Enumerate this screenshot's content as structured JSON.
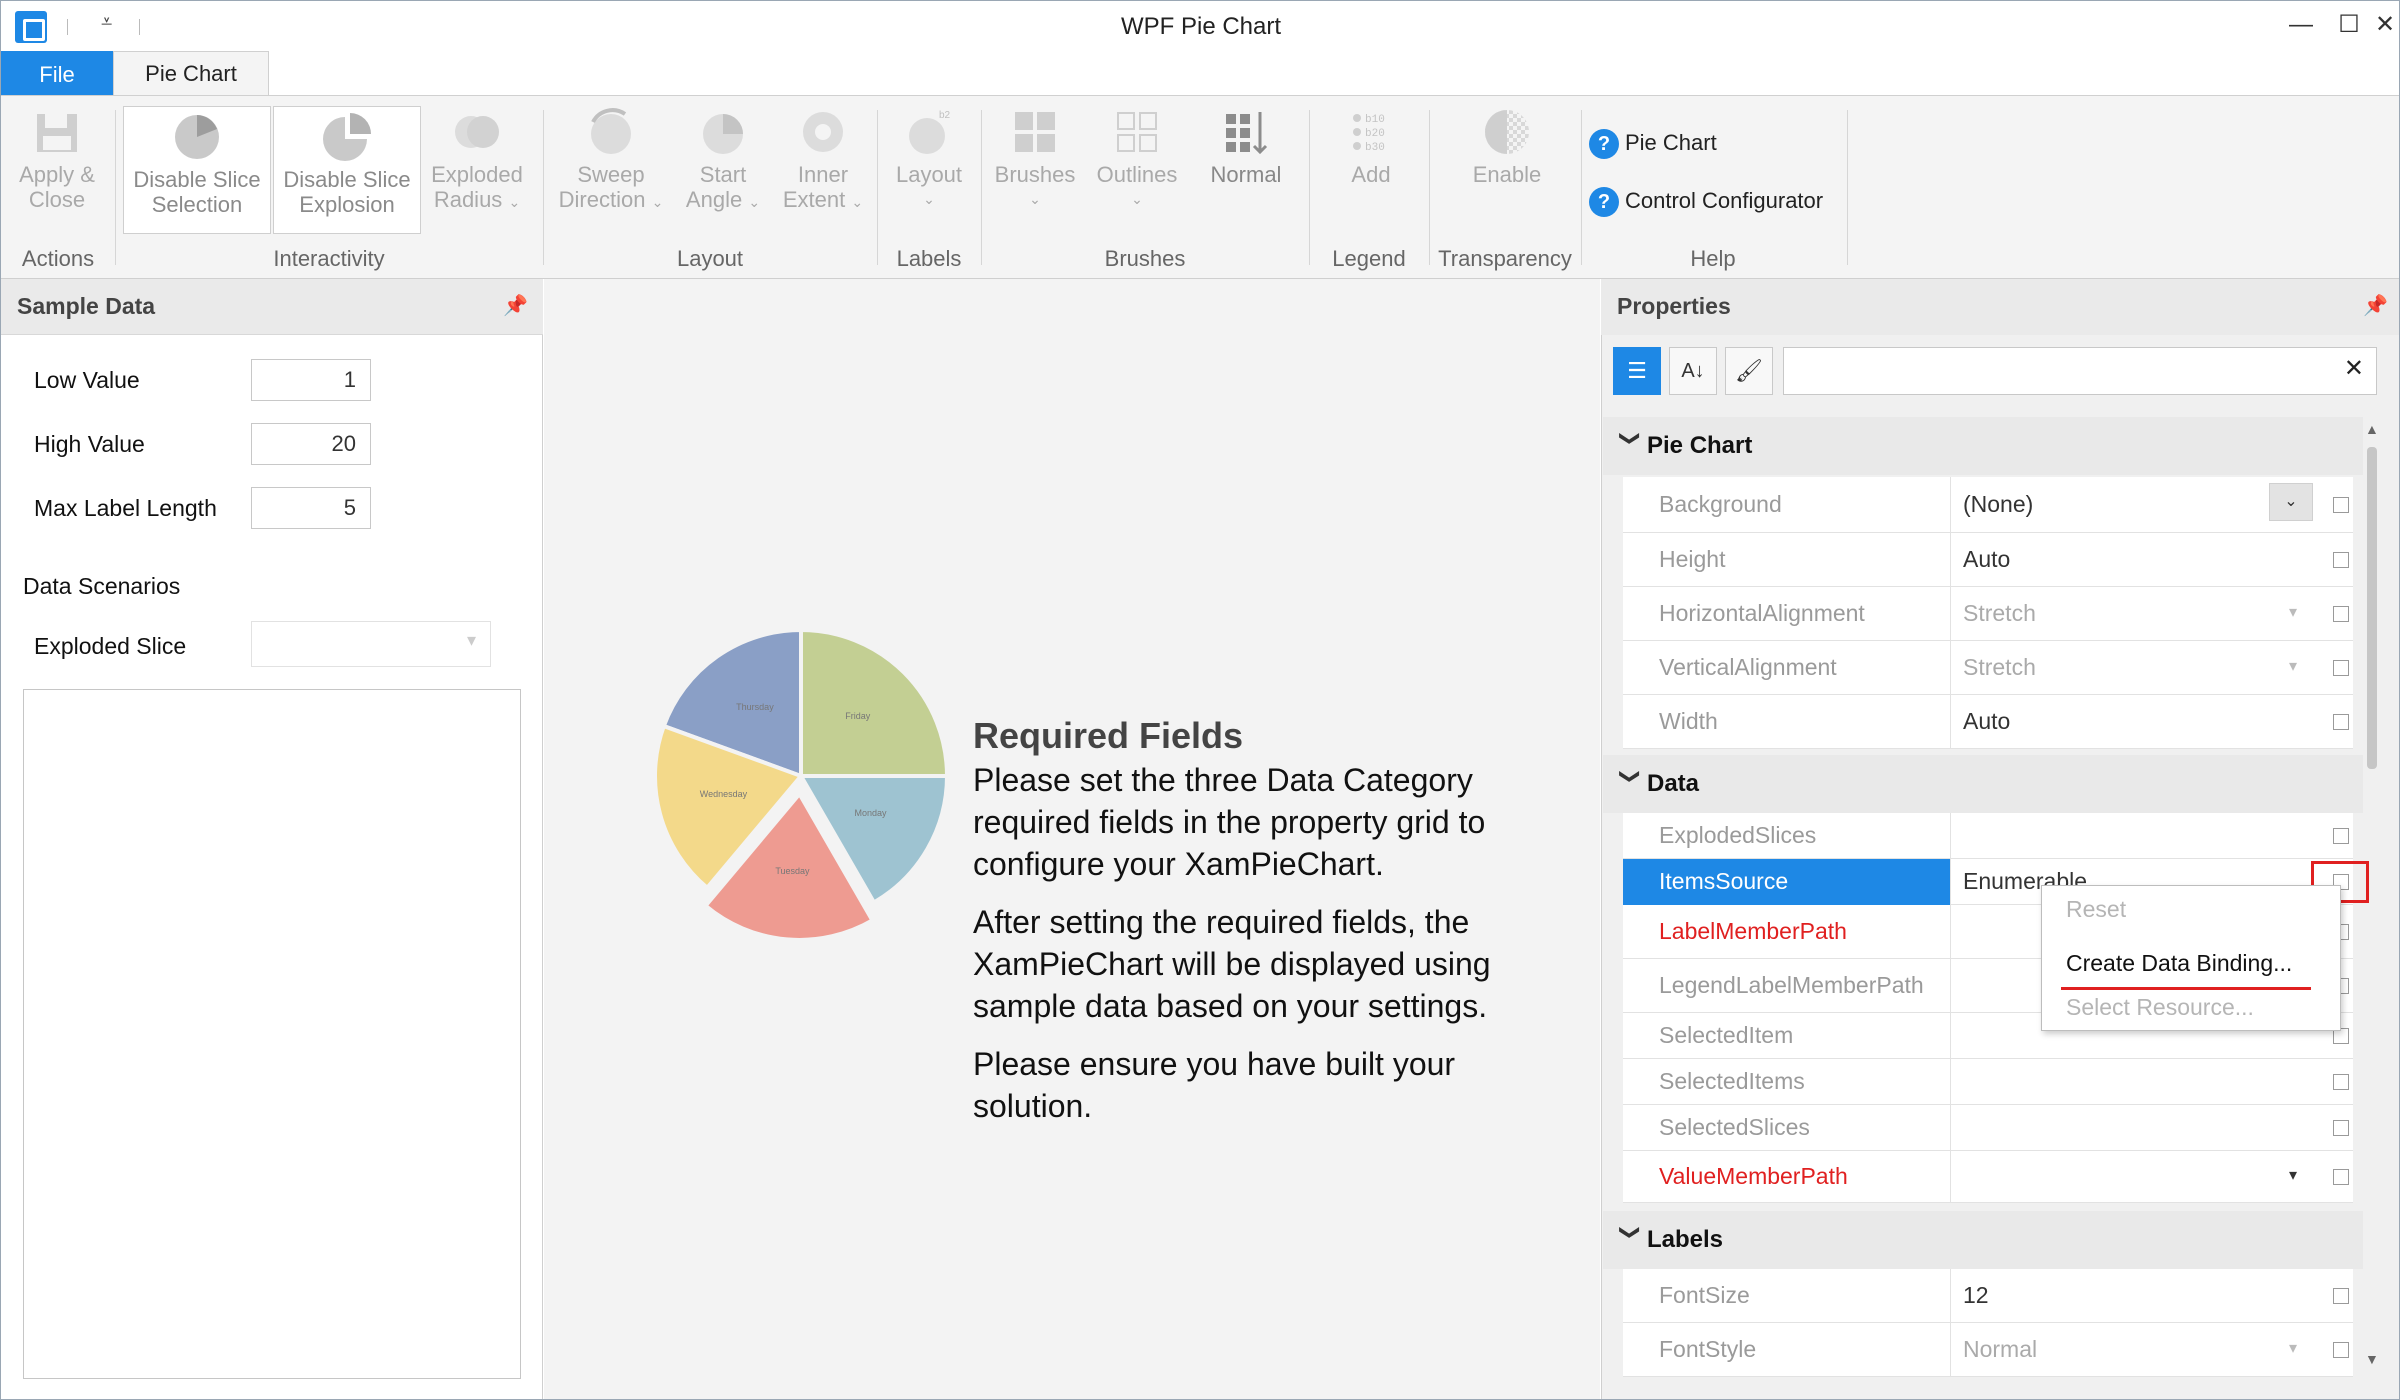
{
  "window": {
    "title": "WPF Pie Chart",
    "controls": {
      "minimize": "—",
      "maximize": "☐",
      "close": "✕"
    }
  },
  "ribbon": {
    "tabs": [
      "File",
      "Pie Chart"
    ],
    "groups": {
      "actions": {
        "label": "Actions",
        "apply_close": [
          "Apply &",
          "Close"
        ]
      },
      "interactivity": {
        "label": "Interactivity",
        "disable_slice_selection": [
          "Disable Slice",
          "Selection"
        ],
        "disable_slice_explosion": [
          "Disable Slice",
          "Explosion"
        ],
        "exploded_radius": [
          "Exploded",
          "Radius"
        ]
      },
      "layout": {
        "label": "Layout",
        "sweep_direction": [
          "Sweep",
          "Direction"
        ],
        "start_angle": [
          "Start",
          "Angle"
        ],
        "inner_extent": [
          "Inner",
          "Extent"
        ]
      },
      "labels": {
        "label": "Labels",
        "layout": "Layout"
      },
      "brushes": {
        "label": "Brushes",
        "brushes": "Brushes",
        "outlines": "Outlines",
        "normal": "Normal"
      },
      "legend": {
        "label": "Legend",
        "add": "Add",
        "icon_lines": [
          "b10",
          "b20",
          "b30"
        ]
      },
      "transparency": {
        "label": "Transparency",
        "enable": "Enable"
      },
      "help": {
        "label": "Help",
        "pie_chart": "Pie Chart",
        "control_configurator": "Control Configurator"
      }
    }
  },
  "sample_data": {
    "title": "Sample Data",
    "low_value": {
      "label": "Low Value",
      "value": "1"
    },
    "high_value": {
      "label": "High Value",
      "value": "20"
    },
    "max_label_length": {
      "label": "Max Label Length",
      "value": "5"
    },
    "data_scenarios": "Data Scenarios",
    "exploded_slice": {
      "label": "Exploded Slice",
      "value": ""
    }
  },
  "center": {
    "pie_labels": [
      "Thursday",
      "Friday",
      "Monday",
      "Tuesday",
      "Wednesday"
    ],
    "pie_colors": [
      "#8a9fc6",
      "#c3cf93",
      "#9ec3d1",
      "#ee9b91",
      "#f3d98a"
    ],
    "title": "Required Fields",
    "p1": "Please set the three Data Category required fields in the property grid to configure your XamPieChart.",
    "p2": "After setting the required fields, the XamPieChart will be displayed using sample data based on your settings.",
    "p3": "Please ensure you have built your solution."
  },
  "properties": {
    "title": "Properties",
    "search_value": "",
    "categories": {
      "pie_chart": "Pie Chart",
      "data": "Data",
      "labels": "Labels"
    },
    "pie_chart_rows": [
      {
        "name": "Background",
        "value": "(None)"
      },
      {
        "name": "Height",
        "value": "Auto"
      },
      {
        "name": "HorizontalAlignment",
        "value": "Stretch"
      },
      {
        "name": "VerticalAlignment",
        "value": "Stretch"
      },
      {
        "name": "Width",
        "value": "Auto"
      }
    ],
    "data_rows": [
      {
        "name": "ExplodedSlices",
        "value": ""
      },
      {
        "name": "ItemsSource",
        "value": "Enumerable"
      },
      {
        "name": "LabelMemberPath",
        "value": ""
      },
      {
        "name": "LegendLabelMemberPath",
        "value": ""
      },
      {
        "name": "SelectedItem",
        "value": ""
      },
      {
        "name": "SelectedItems",
        "value": ""
      },
      {
        "name": "SelectedSlices",
        "value": ""
      },
      {
        "name": "ValueMemberPath",
        "value": ""
      }
    ],
    "labels_rows": [
      {
        "name": "FontSize",
        "value": "12"
      },
      {
        "name": "FontStyle",
        "value": "Normal"
      }
    ],
    "context_menu": {
      "reset": "Reset",
      "create_binding": "Create Data Binding...",
      "select_resource": "Select Resource..."
    }
  }
}
